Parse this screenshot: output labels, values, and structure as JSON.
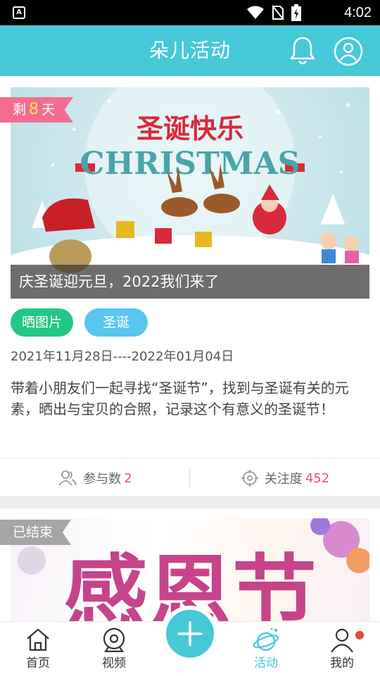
{
  "status_bar": {
    "time": "4:02",
    "app_icon_letter": "A"
  },
  "header": {
    "title": "朵儿活动"
  },
  "cards": [
    {
      "remaining_prefix": "剩",
      "remaining_days": "8",
      "remaining_suffix": "天",
      "banner_headline": "圣诞快乐",
      "banner_word": "CHRISTMAS",
      "image_caption": "庆圣诞迎元旦，2022我们来了",
      "tags": [
        "晒图片",
        "圣诞"
      ],
      "date_range": "2021年11月28日----2022年01月04日",
      "description": "带着小朋友们一起寻找“圣诞节”，找到与圣诞有关的元素，晒出与宝贝的合照，记录这个有意义的圣诞节！",
      "participants_label": "参与数",
      "participants_value": "2",
      "attention_label": "关注度",
      "attention_value": "452"
    },
    {
      "status_label": "已结束",
      "banner_headline": "感恩节"
    }
  ],
  "bottom_nav": [
    {
      "label": "首页",
      "icon": "home-icon"
    },
    {
      "label": "视频",
      "icon": "video-icon"
    },
    {
      "label": "活动",
      "icon": "planet-icon",
      "active": true
    },
    {
      "label": "我的",
      "icon": "person-icon"
    }
  ],
  "colors": {
    "primary": "#45c9d8",
    "ribbon_pink": "#f36d90",
    "tag_green": "#23c886",
    "tag_blue": "#58c6ee",
    "count_red": "#e6507b",
    "badge_red": "#f0413d"
  }
}
